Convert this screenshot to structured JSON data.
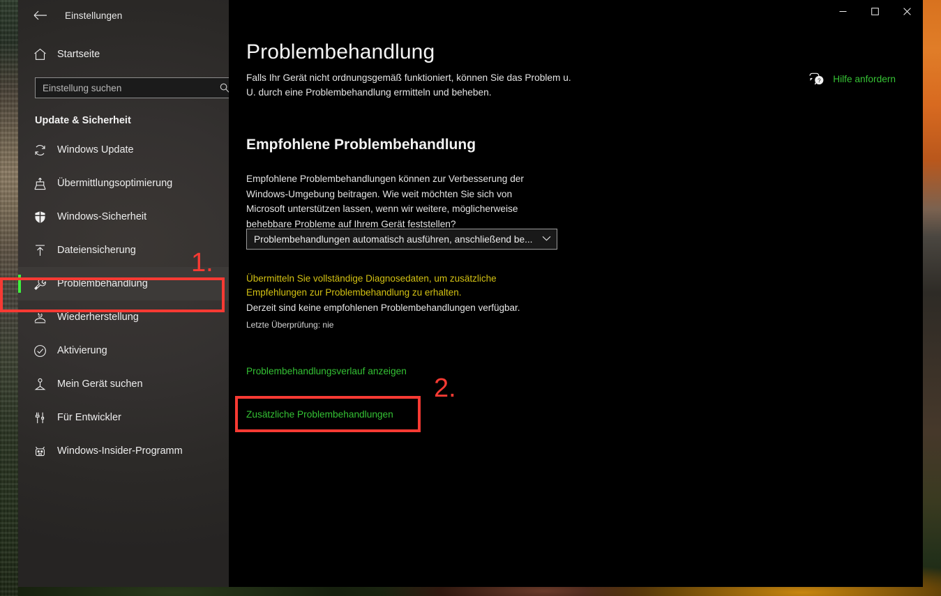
{
  "window": {
    "app_title": "Einstellungen",
    "back_icon": "back-arrow-icon",
    "controls": {
      "minimize": "minimize-icon",
      "maximize": "maximize-icon",
      "close": "close-icon"
    }
  },
  "sidebar": {
    "home_label": "Startseite",
    "home_icon": "home-icon",
    "search": {
      "placeholder": "Einstellung suchen",
      "value": "",
      "icon": "search-icon"
    },
    "section_header": "Update & Sicherheit",
    "items": [
      {
        "label": "Windows Update",
        "icon": "sync-icon",
        "selected": false
      },
      {
        "label": "Übermittlungsoptimierung",
        "icon": "upload-box-icon",
        "selected": false
      },
      {
        "label": "Windows-Sicherheit",
        "icon": "shield-icon",
        "selected": false
      },
      {
        "label": "Dateiensicherung",
        "icon": "upload-icon",
        "selected": false
      },
      {
        "label": "Problembehandlung",
        "icon": "wrench-icon",
        "selected": true
      },
      {
        "label": "Wiederherstellung",
        "icon": "recovery-icon",
        "selected": false
      },
      {
        "label": "Aktivierung",
        "icon": "check-circle-icon",
        "selected": false
      },
      {
        "label": "Mein Gerät suchen",
        "icon": "find-device-icon",
        "selected": false
      },
      {
        "label": "Für Entwickler",
        "icon": "tools-icon",
        "selected": false
      },
      {
        "label": "Windows-Insider-Programm",
        "icon": "insider-bug-icon",
        "selected": false
      }
    ]
  },
  "main": {
    "page_title": "Problembehandlung",
    "page_description": "Falls Ihr Gerät nicht ordnungsgemäß funktioniert, können Sie das Problem u. U. durch eine Problembehandlung ermitteln und beheben.",
    "help": {
      "label": "Hilfe anfordern",
      "icon": "help-question-bubble-icon"
    },
    "section_title": "Empfohlene Problembehandlung",
    "section_description": "Empfohlene Problembehandlungen können zur Verbesserung der Windows-Umgebung beitragen. Wie weit möchten Sie sich von Microsoft unterstützen lassen, wenn wir weitere, möglicherweise behebbare Probleme auf Ihrem Gerät feststellen?",
    "dropdown": {
      "selected_value": "Problembehandlungen automatisch ausführen, anschließend be...",
      "chevron_icon": "chevron-down-icon"
    },
    "diagnostic_link": "Übermitteln Sie vollständige Diagnosedaten, um zusätzliche Empfehlungen zur Problembehandlung zu erhalten.",
    "status_text": "Derzeit sind keine empfohlenen Problembehandlungen verfügbar.",
    "last_check": "Letzte Überprüfung: nie",
    "link_history": "Problembehandlungsverlauf anzeigen",
    "link_additional": "Zusätzliche Problembehandlungen"
  },
  "annotations": {
    "step1": "1.",
    "step2": "2."
  },
  "colors": {
    "accent_green": "#34c134",
    "selection_bar": "#3df23d",
    "diagnostic_yellow": "#d3c113",
    "annotation_red": "#f73a33",
    "sidebar_bg": "#343130",
    "content_bg": "#000000"
  }
}
